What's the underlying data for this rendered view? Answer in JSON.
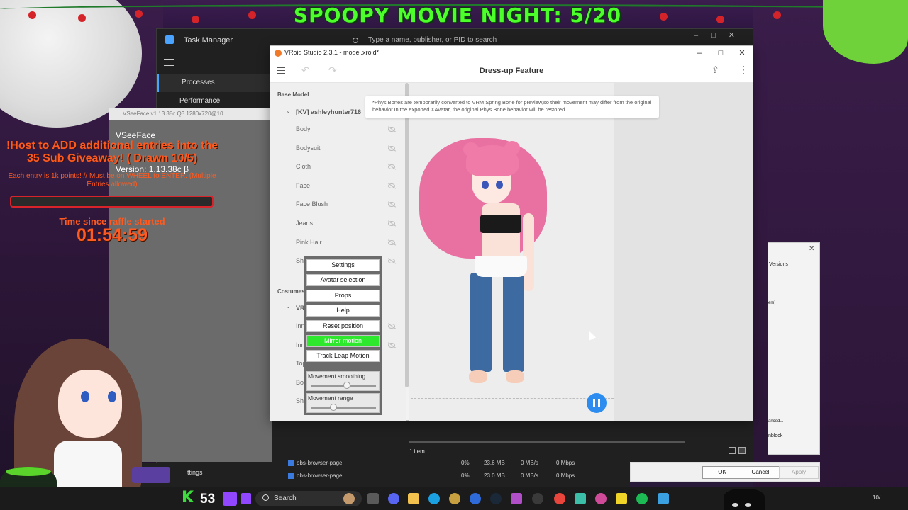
{
  "overlay": {
    "banner_title": "SPOOPY MOVIE NIGHT: 5/20",
    "giveaway_title": "!Host to ADD additional entries into the 35 Sub Giveaway! ( Drawn 10/5)",
    "giveaway_sub": "Each entry is 1k points! // Must be on WHEEL to ENTER. (Multiple Entries allowed)",
    "time_label": "Time since raffle started",
    "time_value": "01:54:59"
  },
  "task_manager": {
    "title": "Task Manager",
    "search_placeholder": "Type a name, publisher, or PID to search",
    "nav": [
      {
        "label": "Processes",
        "selected": true
      },
      {
        "label": "Performance",
        "selected": false
      }
    ],
    "footer_items": "1 item",
    "rows": [
      {
        "name": "obs-browser-page",
        "cpu": "0%",
        "memory": "23.6 MB",
        "disk": "0 MB/s",
        "network": "0 Mbps"
      },
      {
        "name": "obs-browser-page",
        "cpu": "0%",
        "memory": "23.0 MB",
        "disk": "0 MB/s",
        "network": "0 Mbps"
      }
    ],
    "bottom_label": "ttings"
  },
  "vseeface": {
    "titlebar": "VSeeFace v1.13.38c Q3 1280x720@10",
    "name": "VSeeFace",
    "version": "Version: 1.13.38c β",
    "menu": {
      "settings": "Settings",
      "avatar_selection": "Avatar selection",
      "props": "Props",
      "help": "Help",
      "reset_position": "Reset position",
      "mirror_motion": "Mirror motion",
      "track_leap": "Track Leap Motion",
      "movement_smoothing": "Movement smoothing",
      "movement_range": "Movement range",
      "movement_smoothing_value": 0.55,
      "movement_range_value": 0.35
    }
  },
  "vroid": {
    "window_title": "VRoid Studio 2.3.1 - model.xroid*",
    "feature_title": "Dress-up Feature",
    "notice": "*Phys Bones are temporarily converted to VRM Spring Bone for preview,so their movement may differ from the original behavior.In the exported XAvatar, the original Phys Bone behavior will be restored.",
    "base_model_label": "Base Model",
    "avatar_name": "[KV] ashleyhunter716",
    "layers": [
      "Body",
      "Bodysuit",
      "Cloth",
      "Face",
      "Face Blush",
      "Jeans",
      "Pink Hair",
      "Sh"
    ],
    "costumes_label": "Costumes",
    "costume_group": "VR",
    "costume_items": [
      "Inn",
      "Inn",
      "Tops",
      "Bot",
      "She"
    ],
    "accent_color": "#2d8cf0"
  },
  "dialog": {
    "versions_label": "Versions",
    "small1": "em)",
    "small2": "anced...",
    "small3": "nblock",
    "ok": "OK",
    "cancel": "Cancel",
    "apply": "Apply",
    "close_icon": "close-icon"
  },
  "taskbar": {
    "k_label": "K",
    "count": "53",
    "search_label": "Search",
    "date_fragment": "10/"
  }
}
